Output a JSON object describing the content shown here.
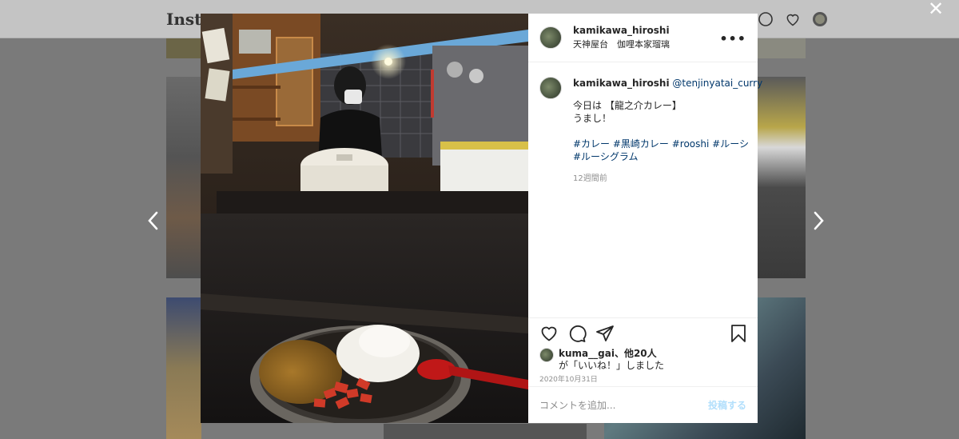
{
  "background": {
    "logo": "Insta"
  },
  "post": {
    "username": "kamikawa_hiroshi",
    "location": "天神屋台　伽哩本家瑠璃",
    "caption": {
      "username": "kamikawa_hiroshi",
      "mention": "@tenjinyatai_curry",
      "line1": "今日は 【龍之介カレー】",
      "line2": "うまし！",
      "hashtags_line1": "#カレー #黒崎カレー #rooshi #ルーシ",
      "hashtags_line2": "#ルーシグラム",
      "relative_time": "12週間前"
    },
    "likes": {
      "user": "kuma__gai",
      "others": "、他20人",
      "suffix": "が「いいね！」しました"
    },
    "date": "2020年10月31日",
    "comment_placeholder": "コメントを追加...",
    "post_button": "投稿する",
    "more_label": "•••",
    "close_label": "✕"
  },
  "colors": {
    "link": "#00376b",
    "post_button": "#b2dffc",
    "overlay": "#7a7a7a"
  }
}
